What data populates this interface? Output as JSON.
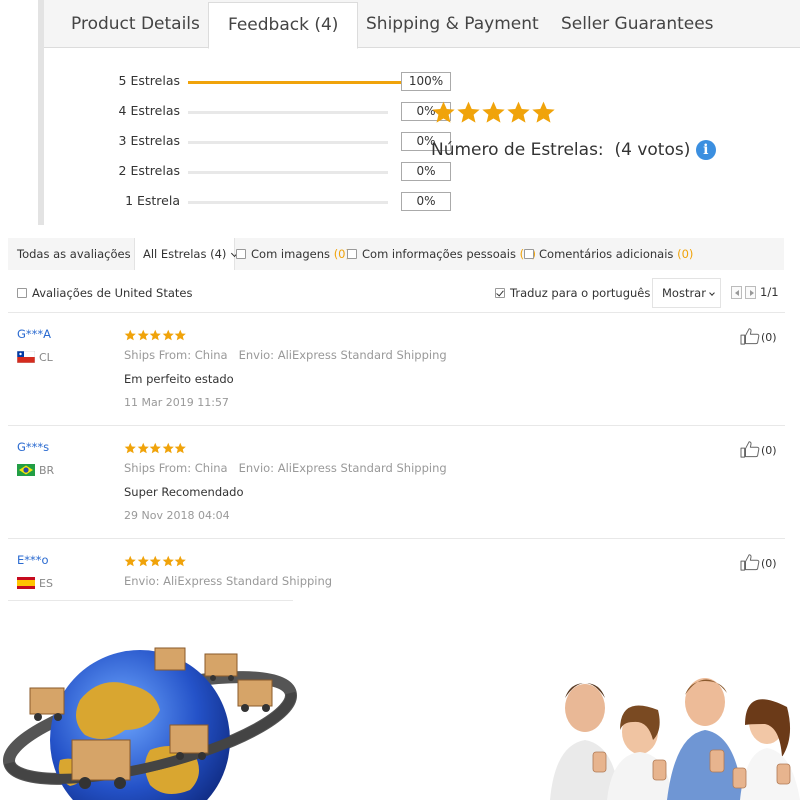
{
  "tabs": [
    {
      "label": "Product Details",
      "active": false
    },
    {
      "label": "Feedback (4)",
      "active": true
    },
    {
      "label": "Shipping & Payment",
      "active": false
    },
    {
      "label": "Seller Guarantees",
      "active": false
    }
  ],
  "ratings": [
    {
      "label": "5 Estrelas",
      "percent_text": "100%",
      "percent": 100
    },
    {
      "label": "4 Estrelas",
      "percent_text": "0%",
      "percent": 0
    },
    {
      "label": "3 Estrelas",
      "percent_text": "0%",
      "percent": 0
    },
    {
      "label": "2 Estrelas",
      "percent_text": "0%",
      "percent": 0
    },
    {
      "label": "1 Estrela",
      "percent_text": "0%",
      "percent": 0
    }
  ],
  "summary": {
    "stars": 5,
    "label": "Número de Estrelas:",
    "votes": "(4 votos)",
    "info_glyph": "i"
  },
  "filters": {
    "all_reviews": "Todas as avaliações",
    "star_select": "All Estrelas (4)",
    "with_images": {
      "label": "Com imagens",
      "count": "(0)",
      "checked": false
    },
    "personal_info": {
      "label": "Com informações pessoais",
      "count": "(0)",
      "checked": false
    },
    "additional": {
      "label": "Comentários adicionais",
      "count": "(0)",
      "checked": false
    },
    "us_reviews": {
      "label": "Avaliações de United States",
      "checked": false
    },
    "translate": {
      "label": "Traduz para o português",
      "checked": true
    },
    "show_label": "Mostrar",
    "page": "1/1"
  },
  "reviews": [
    {
      "user": "G***A",
      "country": "CL",
      "stars": 5,
      "ship_from": "Ships From: China",
      "shipping": "Envio: AliExpress Standard Shipping",
      "text": "Em perfeito estado",
      "date": "11 Mar 2019 11:57",
      "likes": "(0)"
    },
    {
      "user": "G***s",
      "country": "BR",
      "stars": 5,
      "ship_from": "Ships From: China",
      "shipping": "Envio: AliExpress Standard Shipping",
      "text": "Super Recomendado",
      "date": "29 Nov 2018 04:04",
      "likes": "(0)"
    },
    {
      "user": "E***o",
      "country": "ES",
      "stars": 5,
      "ship_from": "",
      "shipping": "Envio: AliExpress Standard Shipping",
      "text": "",
      "date": "",
      "likes": "(0)"
    }
  ],
  "colors": {
    "star": "#f0a30a",
    "link": "#2a6ad0",
    "info": "#3b8fe0"
  },
  "icons": [
    "star-icon",
    "info-icon",
    "thumbs-up-icon",
    "checkbox-icon",
    "chevron-down-icon",
    "chevron-left-icon",
    "chevron-right-icon",
    "flag-cl-icon",
    "flag-br-icon",
    "flag-es-icon"
  ]
}
